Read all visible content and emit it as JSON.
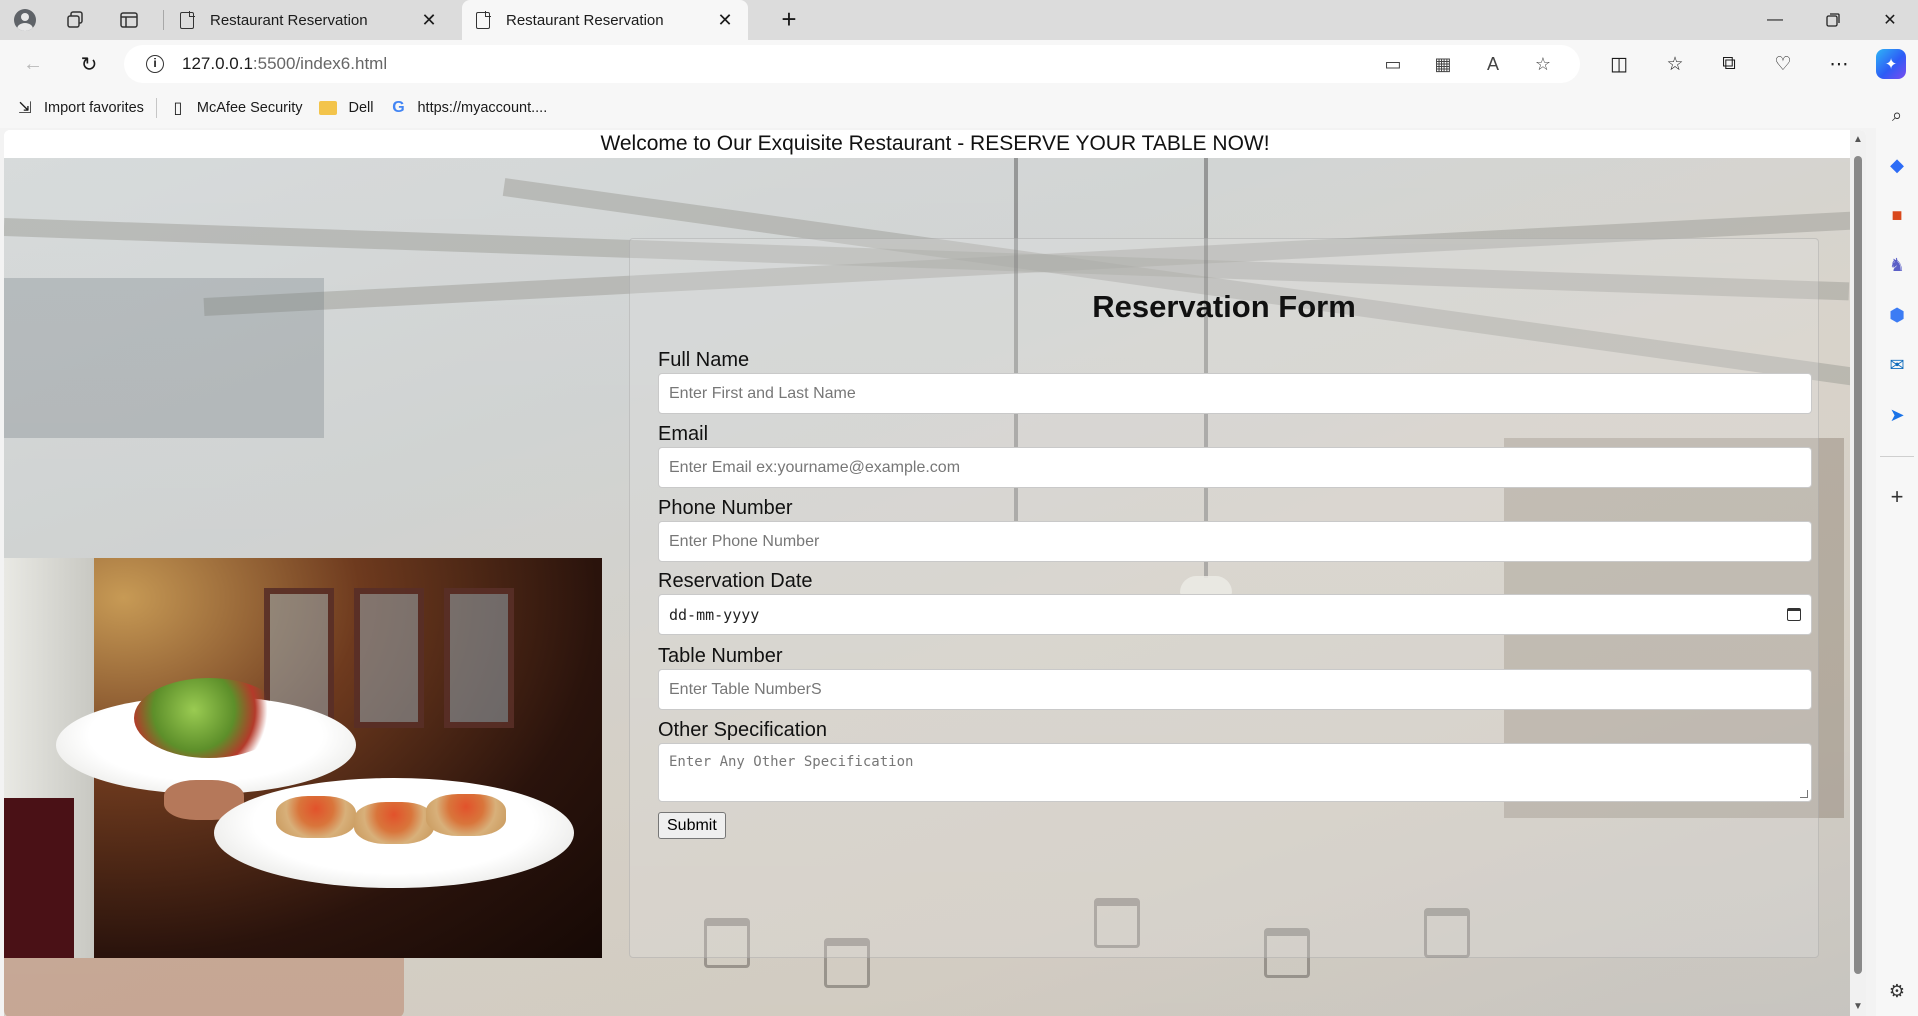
{
  "browser": {
    "tabs": [
      {
        "title": "Restaurant Reservation",
        "active": false
      },
      {
        "title": "Restaurant Reservation",
        "active": true
      }
    ],
    "url_host": "127.0.0.1",
    "url_path": ":5500/index6.html",
    "bookmarks": [
      {
        "label": "Import favorites",
        "icon": "import-icon"
      },
      {
        "label": "McAfee Security",
        "icon": "page-icon"
      },
      {
        "label": "Dell",
        "icon": "folder-icon"
      },
      {
        "label": "https://myaccount....",
        "icon": "google-icon"
      }
    ],
    "accent_color": "#2d5cf6"
  },
  "page": {
    "welcome": "Welcome to Our Exquisite Restaurant - RESERVE YOUR TABLE NOW!",
    "form": {
      "title": "Reservation Form",
      "full_name_label": "Full Name",
      "full_name_placeholder": "Enter First and Last Name",
      "email_label": "Email",
      "email_placeholder": "Enter Email ex:yourname@example.com",
      "phone_label": "Phone Number",
      "phone_placeholder": "Enter Phone Number",
      "date_label": "Reservation Date",
      "date_placeholder": "dd-mm-yyyy",
      "table_label": "Table Number",
      "table_placeholder": "Enter Table NumberS",
      "other_label": "Other Specification",
      "other_placeholder": "Enter Any Other Specification",
      "submit_label": "Submit"
    }
  }
}
